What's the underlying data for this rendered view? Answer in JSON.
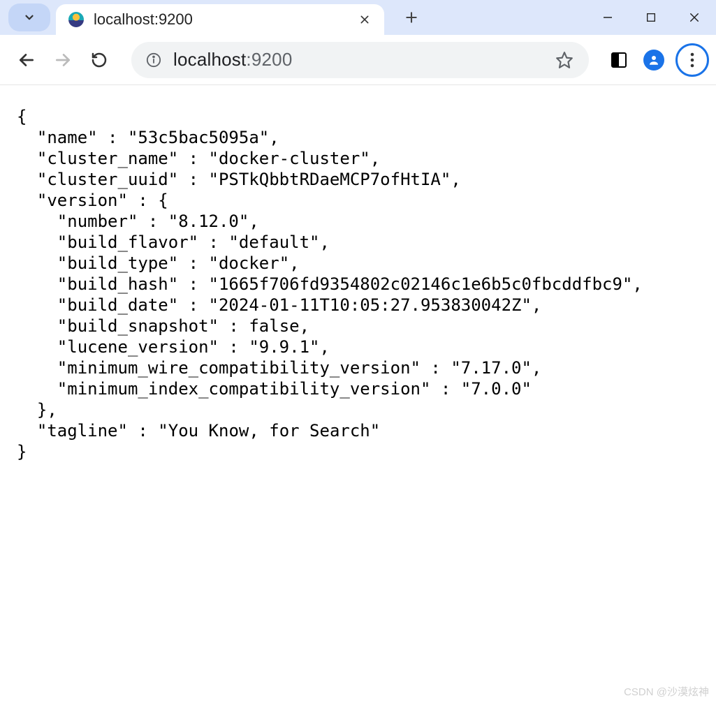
{
  "tab": {
    "title": "localhost:9200"
  },
  "address_bar": {
    "host": "localhost",
    "port": ":9200"
  },
  "response": {
    "name": "53c5bac5095a",
    "cluster_name": "docker-cluster",
    "cluster_uuid": "PSTkQbbtRDaeMCP7ofHtIA",
    "version_number": "8.12.0",
    "build_flavor": "default",
    "build_type": "docker",
    "build_hash": "1665f706fd9354802c02146c1e6b5c0fbcddfbc9",
    "build_date": "2024-01-11T10:05:27.953830042Z",
    "build_snapshot": "false",
    "lucene_version": "9.9.1",
    "minimum_wire_compatibility_version": "7.17.0",
    "minimum_index_compatibility_version": "7.0.0",
    "tagline": "You Know, for Search"
  },
  "watermark": "CSDN @沙漠炫神"
}
